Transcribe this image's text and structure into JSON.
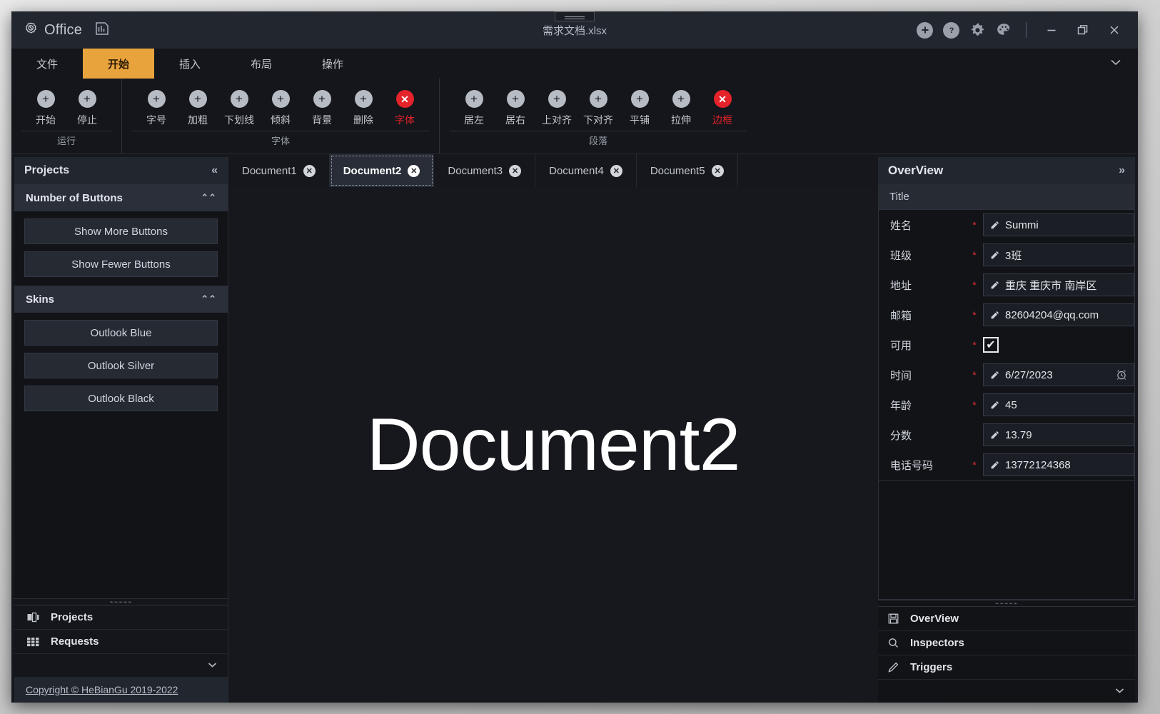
{
  "window": {
    "brand": "Office",
    "brand_icon": "office-logo-icon",
    "doc_type_icon": "spreadsheet-icon",
    "title": "需求文档.xlsx",
    "actions": [
      {
        "name": "add-button",
        "icon": "plus-icon",
        "glyph": "+"
      },
      {
        "name": "help-button",
        "icon": "question-icon",
        "glyph": "?"
      },
      {
        "name": "settings-button",
        "icon": "gear-icon",
        "glyph": "✿"
      },
      {
        "name": "theme-button",
        "icon": "palette-icon",
        "glyph": "◕"
      }
    ],
    "minimize_label": "—",
    "restore_label": "❐",
    "close_label": "✕"
  },
  "ribbon": {
    "tabs": [
      {
        "label": "文件",
        "active": false
      },
      {
        "label": "开始",
        "active": true
      },
      {
        "label": "插入",
        "active": false
      },
      {
        "label": "布局",
        "active": false
      },
      {
        "label": "操作",
        "active": false
      }
    ],
    "collapse_icon": "chevron-down-icon",
    "groups": [
      {
        "name": "运行",
        "items": [
          {
            "label": "开始",
            "glyph": "+",
            "danger": false
          },
          {
            "label": "停止",
            "glyph": "+",
            "danger": false
          }
        ]
      },
      {
        "name": "字体",
        "items": [
          {
            "label": "字号",
            "glyph": "+",
            "danger": false
          },
          {
            "label": "加粗",
            "glyph": "+",
            "danger": false
          },
          {
            "label": "下划线",
            "glyph": "+",
            "danger": false
          },
          {
            "label": "倾斜",
            "glyph": "+",
            "danger": false
          },
          {
            "label": "背景",
            "glyph": "+",
            "danger": false
          },
          {
            "label": "删除",
            "glyph": "+",
            "danger": false
          },
          {
            "label": "字体",
            "glyph": "✕",
            "danger": true
          }
        ]
      },
      {
        "name": "段落",
        "items": [
          {
            "label": "居左",
            "glyph": "+",
            "danger": false
          },
          {
            "label": "居右",
            "glyph": "+",
            "danger": false
          },
          {
            "label": "上对齐",
            "glyph": "+",
            "danger": false
          },
          {
            "label": "下对齐",
            "glyph": "+",
            "danger": false
          },
          {
            "label": "平铺",
            "glyph": "+",
            "danger": false
          },
          {
            "label": "拉伸",
            "glyph": "+",
            "danger": false
          },
          {
            "label": "边框",
            "glyph": "✕",
            "danger": true
          }
        ]
      }
    ]
  },
  "sidebar": {
    "header": "Projects",
    "collapse_icon": "chevron-double-left-icon",
    "groups": [
      {
        "title": "Number of Buttons",
        "chevron_icon": "chevron-double-up-icon",
        "buttons": [
          "Show More Buttons",
          "Show Fewer Buttons"
        ]
      },
      {
        "title": "Skins",
        "chevron_icon": "chevron-double-up-icon",
        "buttons": [
          "Outlook Blue",
          "Outlook Silver",
          "Outlook Black"
        ]
      }
    ],
    "nav": [
      {
        "label": "Projects",
        "icon": "projects-icon"
      },
      {
        "label": "Requests",
        "icon": "grid-icon"
      }
    ],
    "more_icon": "chevron-down-icon",
    "copyright": "Copyright © HeBianGu 2019-2022"
  },
  "documents": {
    "tabs": [
      {
        "label": "Document1",
        "active": false
      },
      {
        "label": "Document2",
        "active": true
      },
      {
        "label": "Document3",
        "active": false
      },
      {
        "label": "Document4",
        "active": false
      },
      {
        "label": "Document5",
        "active": false
      }
    ],
    "close_glyph": "✕",
    "canvas_text": "Document2"
  },
  "overview": {
    "header": "OverView",
    "expand_icon": "chevron-double-right-icon",
    "form_title": "Title",
    "fields": [
      {
        "label": "姓名",
        "required": true,
        "type": "text",
        "value": "Summi"
      },
      {
        "label": "班级",
        "required": true,
        "type": "text",
        "value": "3班"
      },
      {
        "label": "地址",
        "required": true,
        "type": "text",
        "value": "重庆 重庆市 南岸区"
      },
      {
        "label": "邮箱",
        "required": true,
        "type": "text",
        "value": "82604204@qq.com"
      },
      {
        "label": "可用",
        "required": true,
        "type": "checkbox",
        "value": "✔"
      },
      {
        "label": "时间",
        "required": true,
        "type": "date",
        "value": "6/27/2023",
        "tail_icon": "alarm-clock-icon"
      },
      {
        "label": "年龄",
        "required": true,
        "type": "text",
        "value": "45"
      },
      {
        "label": "分数",
        "required": false,
        "type": "text",
        "value": "13.79"
      },
      {
        "label": "电话号码",
        "required": true,
        "type": "text",
        "value": "13772124368"
      }
    ],
    "nav": [
      {
        "label": "OverView",
        "icon": "save-icon"
      },
      {
        "label": "Inspectors",
        "icon": "search-icon"
      },
      {
        "label": "Triggers",
        "icon": "pencil-icon"
      }
    ],
    "more_icon": "chevron-down-icon"
  },
  "colors": {
    "accent": "#e8a33d",
    "danger": "#e4232a",
    "required": "#e03030",
    "window_bg": "#16181d",
    "titlebar_bg": "#22262f"
  }
}
